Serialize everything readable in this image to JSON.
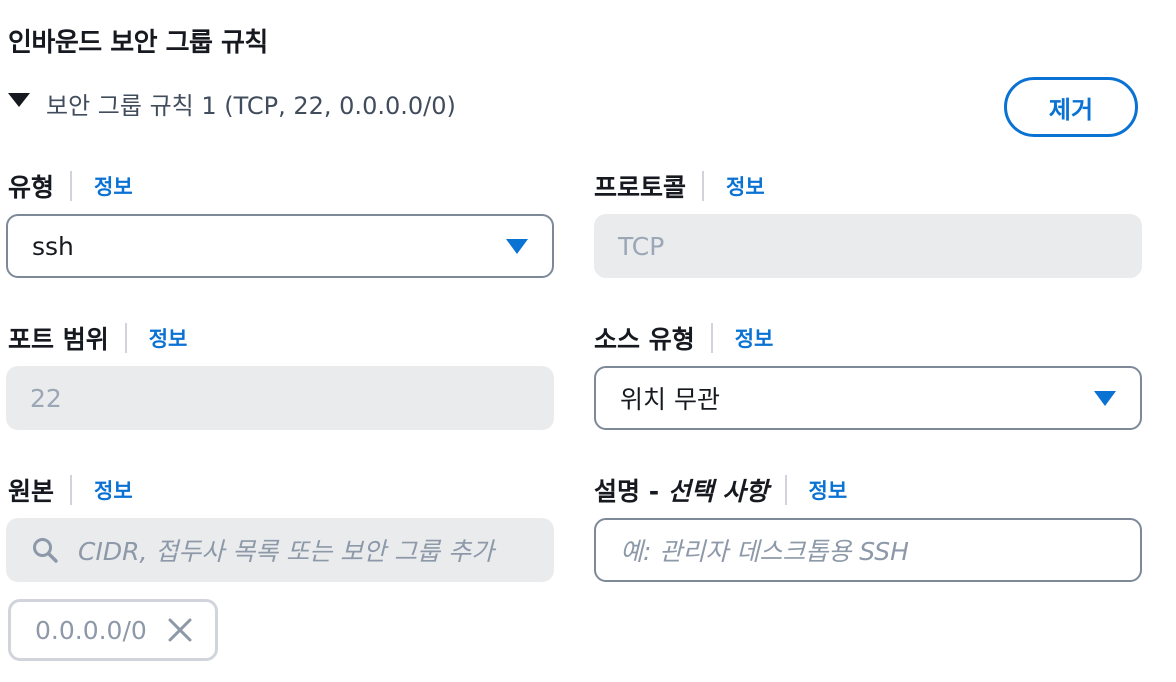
{
  "section": {
    "title": "인바운드 보안 그룹 규칙"
  },
  "rule": {
    "title": "보안 그룹 규칙 1 (TCP, 22, 0.0.0.0/0)",
    "remove_label": "제거"
  },
  "fields": {
    "type": {
      "label": "유형",
      "info": "정보",
      "value": "ssh"
    },
    "protocol": {
      "label": "프로토콜",
      "info": "정보",
      "value": "TCP"
    },
    "port_range": {
      "label": "포트 범위",
      "info": "정보",
      "value": "22"
    },
    "source_type": {
      "label": "소스 유형",
      "info": "정보",
      "value": "위치 무관"
    },
    "source": {
      "label": "원본",
      "info": "정보",
      "placeholder": "CIDR, 접두사 목록 또는 보안 그룹 추가",
      "tokens": [
        "0.0.0.0/0"
      ]
    },
    "description": {
      "label": "설명",
      "label_separator": " - ",
      "label_optional": "선택 사항",
      "info": "정보",
      "placeholder": "예: 관리자 데스크톱용 SSH"
    }
  },
  "colors": {
    "accent": "#0972d3",
    "disabled_bg": "#e9ebed",
    "border": "#7d8998"
  },
  "icons": {
    "caret": "caret-down-icon",
    "select": "triangle-down-icon",
    "search": "search-icon",
    "remove_token": "close-icon"
  }
}
